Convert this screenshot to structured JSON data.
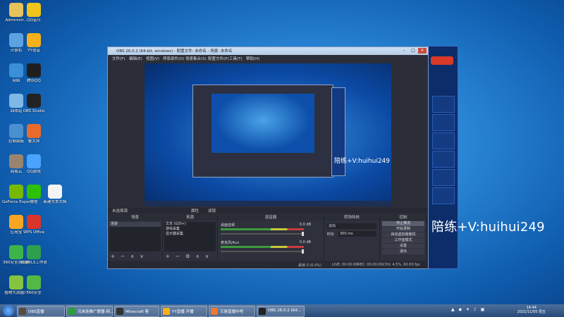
{
  "desktop": {
    "icons": [
      {
        "label": "Administr...",
        "color": "#e8c25a"
      },
      {
        "label": "QQ音乐",
        "color": "#f0c419"
      },
      {
        "label": "计算机",
        "color": "#5aa2e0"
      },
      {
        "label": "YY语音",
        "color": "#f5b01e"
      },
      {
        "label": "网络",
        "color": "#3b8fd8"
      },
      {
        "label": "腾讯QQ",
        "color": "#1f1f1f"
      },
      {
        "label": "回收站",
        "color": "#7fb8e6"
      },
      {
        "label": "OBS Studio",
        "color": "#222222"
      },
      {
        "label": "控制面板",
        "color": "#4a90d0"
      },
      {
        "label": "鲁大师",
        "color": "#e86a2c"
      },
      {
        "label": "网易云",
        "color": "#9a8470"
      },
      {
        "label": "QQ游戏",
        "color": "#4aa3ff"
      },
      {
        "label": "GeForce Experience",
        "color": "#76b900"
      },
      {
        "label": "微信",
        "color": "#2dc100"
      },
      {
        "label": "新建文本文档",
        "color": "#f4f4f4"
      },
      {
        "label": "应用宝",
        "color": "#f6a623"
      },
      {
        "label": "WPS Office",
        "color": "#d9352a"
      },
      {
        "label": "360安全浏览器",
        "color": "#3cb44a"
      },
      {
        "label": "新建XLS工作表",
        "color": "#2e9e4f"
      },
      {
        "label": "植物大战僵尸",
        "color": "#86c440"
      },
      {
        "label": "360安全",
        "color": "#53b944"
      }
    ]
  },
  "overlay": {
    "watermark": "陪练+V:huihui249",
    "watermark_small": "陪练+V:huihui249"
  },
  "obs": {
    "title": "OBS 26.0.2 (64-bit, windows) - 配置文件: 未命名 - 场景: 未命名",
    "menus": [
      "文件(F)",
      "编辑(E)",
      "视图(V)",
      "停靠部件(D)",
      "场景集合(S)",
      "配置文件(P)",
      "工具(T)",
      "帮助(H)"
    ],
    "scene_bar": {
      "label": "未选择源",
      "props": "属性",
      "filters": "滤镜"
    },
    "docks": {
      "scenes": {
        "title": "场景",
        "items": [
          "场景"
        ],
        "footer": "+ − ∧ ∨"
      },
      "sources": {
        "title": "来源",
        "items": [
          "文本 (GDI+)",
          "游戏采集",
          "显示器采集"
        ],
        "footer": "+ − ⚙ ∧ ∨"
      },
      "mixer": {
        "title": "混音器",
        "channels": [
          {
            "name": "桌面音频",
            "db": "0.0 dB",
            "level": 0.6
          },
          {
            "name": "麦克风/Aux",
            "db": "0.0 dB",
            "level": 0.55
          }
        ]
      },
      "transitions": {
        "title": "转场特效",
        "type": "淡出",
        "duration_label": "时长",
        "duration": "300 ms"
      },
      "controls": {
        "title": "控制",
        "buttons": [
          "停止推流",
          "开始录制",
          "启动虚拟摄像机",
          "工作室模式",
          "设置",
          "退出"
        ]
      }
    },
    "status": {
      "dropped": "丢帧 0 (0.0%)",
      "live": "LIVE: 00:00:00",
      "rec": "REC: 00:00:00",
      "cpu": "CPU: 4.5%, 60.00 fps"
    }
  },
  "taskbar": {
    "items": [
      {
        "label": "OBS直播",
        "color": "#5a4b3a"
      },
      {
        "label": "兄弟连推广联盟-网...",
        "color": "#2b9e3b"
      },
      {
        "label": "Minecraft 客",
        "color": "#333333"
      },
      {
        "label": "YY直播 开播",
        "color": "#f5b01e"
      },
      {
        "label": "又是直播中吧",
        "color": "#f07830"
      },
      {
        "label": "OBS 26.0.2 (64...",
        "color": "#222222"
      }
    ],
    "time": "14:44",
    "date": "2021/11/05 周五"
  }
}
